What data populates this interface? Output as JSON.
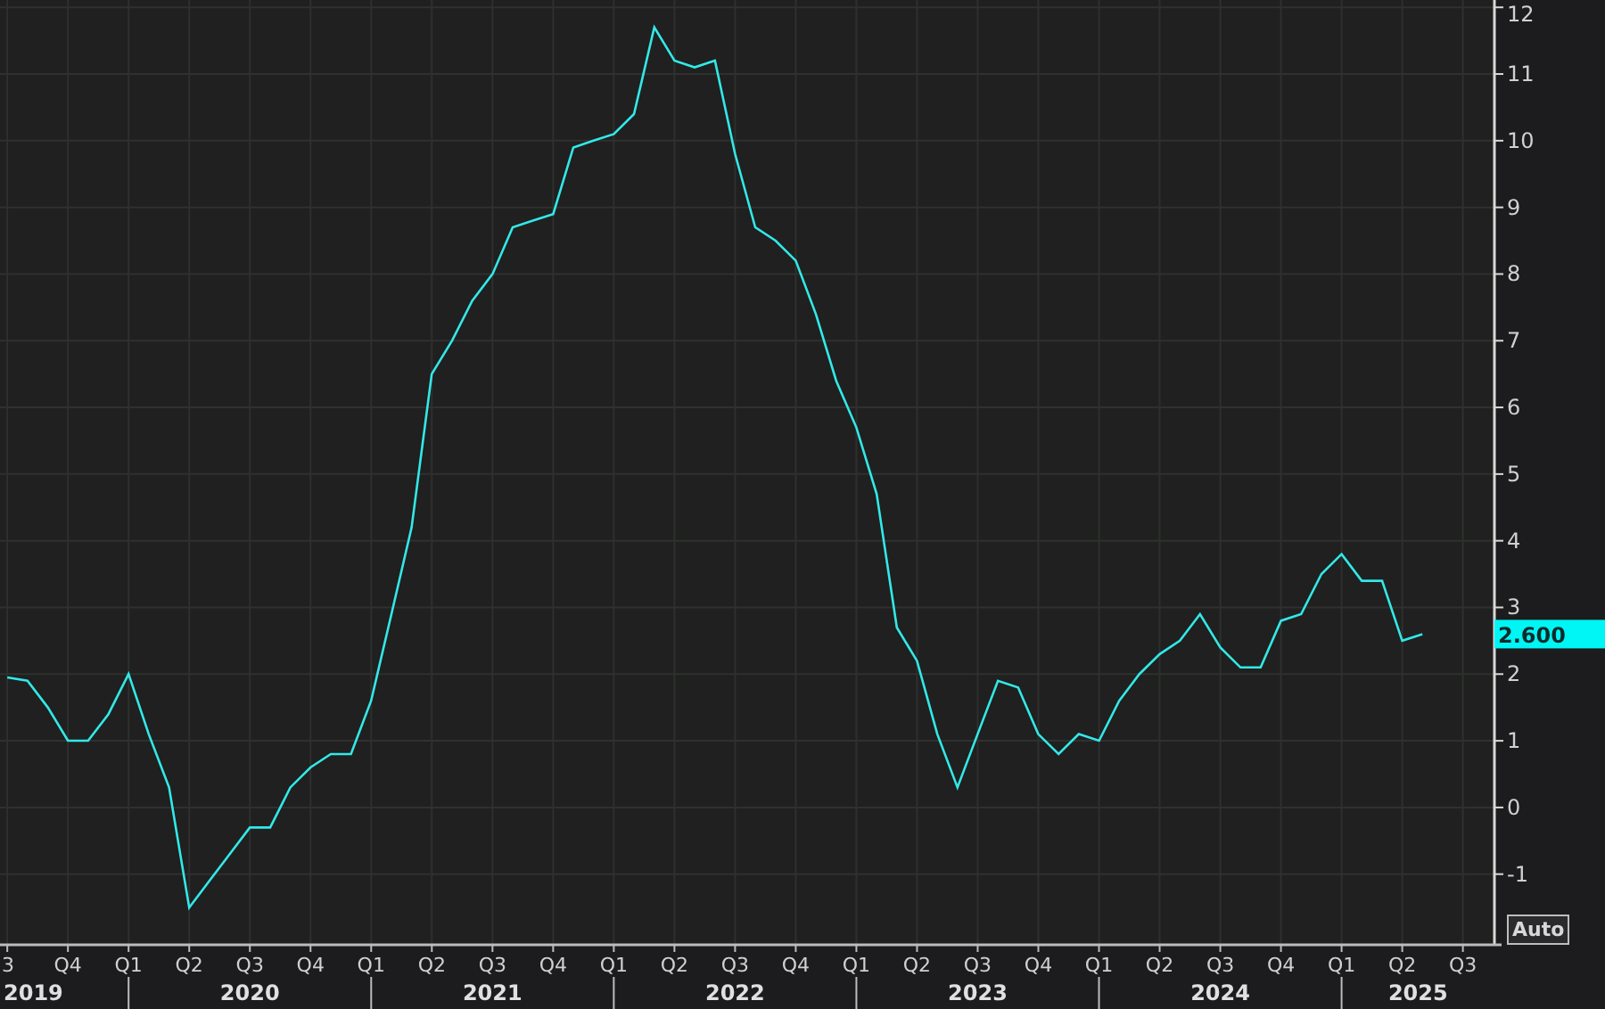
{
  "chart": {
    "chart_data": {
      "type": "line",
      "categories": [
        "3",
        null,
        null,
        "Q4",
        null,
        null,
        "Q1",
        null,
        null,
        "Q2",
        null,
        null,
        "Q3",
        null,
        null,
        "Q4",
        null,
        null,
        "Q1",
        null,
        null,
        "Q2",
        null,
        null,
        "Q3",
        null,
        null,
        "Q4",
        null,
        null,
        "Q1",
        null,
        null,
        "Q2",
        null,
        null,
        "Q3",
        null,
        null,
        "Q4",
        null,
        null,
        "Q1",
        null,
        null,
        "Q2",
        null,
        null,
        "Q3",
        null,
        null,
        "Q4",
        null,
        null,
        "Q1",
        null,
        null,
        "Q2",
        null,
        null,
        "Q3",
        null,
        null,
        "Q4",
        null,
        null,
        "Q1",
        null,
        null,
        "Q2",
        null,
        null,
        "Q3"
      ],
      "series": [
        {
          "color": "#33e8e8",
          "values": [
            1.95,
            1.9,
            1.5,
            1.0,
            1.0,
            1.4,
            2.0,
            1.1,
            0.3,
            -1.5,
            -1.1,
            -0.7,
            -0.3,
            -0.3,
            0.3,
            0.6,
            0.8,
            0.8,
            1.6,
            2.9,
            4.2,
            6.5,
            7.0,
            7.6,
            8.0,
            8.7,
            8.8,
            8.9,
            9.9,
            10.0,
            10.1,
            10.4,
            11.7,
            11.2,
            11.1,
            11.2,
            9.8,
            8.7,
            8.5,
            8.2,
            7.4,
            6.4,
            5.7,
            4.7,
            2.7,
            2.2,
            1.1,
            0.3,
            1.1,
            1.9,
            1.8,
            1.1,
            0.8,
            1.1,
            1.0,
            1.6,
            2.0,
            2.3,
            2.5,
            2.9,
            2.4,
            2.1,
            2.1,
            2.8,
            2.9,
            3.5,
            3.8,
            3.4,
            3.4,
            2.5,
            2.6,
            null,
            null
          ]
        }
      ],
      "ylim": [
        -2.06,
        12.11
      ],
      "yticks": [
        -1,
        0,
        1,
        2,
        3,
        4,
        5,
        6,
        7,
        8,
        9,
        10,
        11,
        12
      ],
      "grid": true
    },
    "year_labels": [
      "2019",
      "2020",
      "2021",
      "2022",
      "2023",
      "2024",
      "2025"
    ],
    "last_value": "2.600"
  },
  "auto_button": "Auto"
}
